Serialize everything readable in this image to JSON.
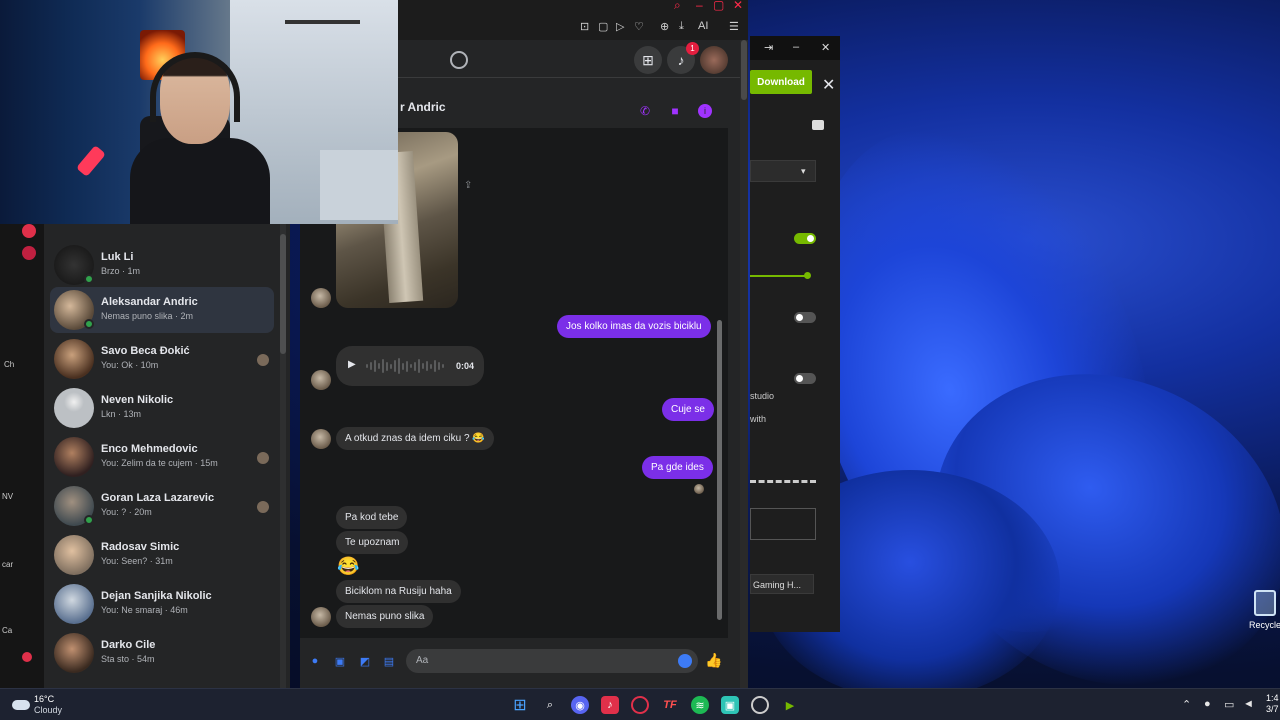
{
  "messenger": {
    "chat_title": "r Andric",
    "composer_placeholder": "Aa",
    "notification_count": "1",
    "voice_duration": "0:04",
    "conversations": [
      {
        "name": "Luk Li",
        "preview": "Brzo · 1m",
        "online": true
      },
      {
        "name": "Aleksandar Andric",
        "preview": "Nemas puno slika · 2m",
        "online": true,
        "active": true
      },
      {
        "name": "Savo Beca Đokić",
        "preview": "You: Ok · 10m",
        "online": false
      },
      {
        "name": "Neven Nikolic",
        "preview": "Lkn · 13m",
        "online": false
      },
      {
        "name": "Enco Mehmedovic",
        "preview": "You: Zelim da te cujem · 15m",
        "online": false
      },
      {
        "name": "Goran Laza Lazarevic",
        "preview": "You: ? · 20m",
        "online": true
      },
      {
        "name": "Radosav Simic",
        "preview": "You: Seen? · 31m",
        "online": false
      },
      {
        "name": "Dejan Sanjika Nikolic",
        "preview": "You: Ne smaraj · 46m",
        "online": false
      },
      {
        "name": "Darko Cile",
        "preview": "Sta sto · 54m",
        "online": false
      }
    ],
    "messages": [
      {
        "side": "out",
        "text": "Jos kolko imas da vozis biciklu"
      },
      {
        "side": "out",
        "text": "Cuje se"
      },
      {
        "side": "in",
        "text": "A otkud znas da idem ciku ? 😂"
      },
      {
        "side": "out",
        "text": "Pa gde ides"
      },
      {
        "side": "in",
        "text": "Pa kod tebe"
      },
      {
        "side": "in",
        "text": "Te upoznam"
      },
      {
        "side": "in",
        "text": "😂"
      },
      {
        "side": "in",
        "text": "Biciklom na Rusiju haha"
      },
      {
        "side": "in",
        "text": "Nemas puno slika"
      }
    ]
  },
  "browser": {
    "ai_label": "AI"
  },
  "right_app": {
    "download_label": "Download",
    "text_studio": "studio",
    "text_with": "with",
    "select_gaming": "Gaming H..."
  },
  "desktop": {
    "recycle_label": "Recycle"
  },
  "taskbar": {
    "temp": "16°C",
    "condition": "Cloudy",
    "clock_time": "1:4",
    "clock_date": "3/7"
  },
  "left_strip_labels": [
    "Ch",
    "NV",
    "car",
    "Ca"
  ],
  "colors": {
    "messenger_bg": "#242526",
    "out_bubble": "#7b2fe8",
    "in_bubble": "#303030",
    "accent_blue": "#3d7bf5",
    "nvidia_green": "#76b900"
  }
}
